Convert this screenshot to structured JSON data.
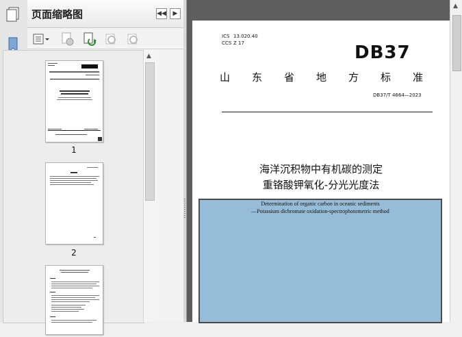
{
  "panel": {
    "title": "页面缩略图",
    "thumbnails": [
      {
        "page_label": "1"
      },
      {
        "page_label": "2"
      }
    ]
  },
  "document": {
    "ics": "ICS",
    "ics_code": "13.020.40",
    "ccs": "CCS",
    "ccs_code": "Z 17",
    "logo": "DB37",
    "org_line": "山东省地方标准",
    "standard_number": "DB37/T 4664—2023",
    "title_line1": "海洋沉积物中有机碳的测定",
    "title_line2": "重铬酸钾氧化-分光光度法",
    "english_line1": "Determination of organic carbon in oceanic sediments",
    "english_line2": "—Potassium dichromate oxidation-spectrophotometric method"
  }
}
